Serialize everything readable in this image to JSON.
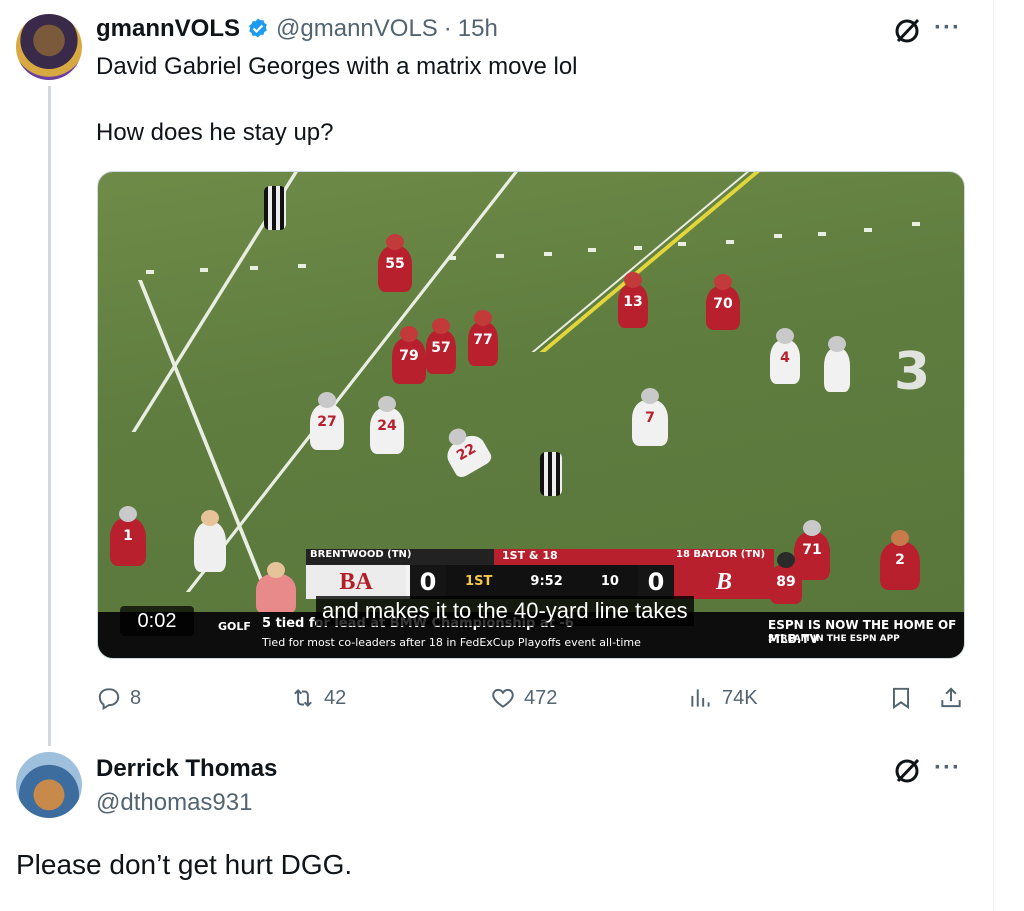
{
  "tweet": {
    "author_name": "gmannVOLS",
    "handle": "@gmannVOLS",
    "separator": "·",
    "time": "15h",
    "text_line1": "David Gabriel Georges with a matrix move lol",
    "text_line2": "How does he stay up?",
    "more": "···",
    "video": {
      "timer": "0:02",
      "caption": "and makes it to the 40-yard line takes",
      "scorebug": {
        "home_team": "BRENTWOOD (TN)",
        "home_logo": "BA",
        "home_score": "0",
        "down": "1ST & 18",
        "quarter": "1ST",
        "clock": "9:52",
        "playclock": "10",
        "away_team": "18 BAYLOR (TN)",
        "away_logo": "B",
        "away_score": "0"
      },
      "ticker": {
        "sport": "GOLF",
        "line1": "5 tied for lead at BMW Championship at -6",
        "line2": "Tied for most co-leaders after 18 in FedExCup Playoffs event all-time",
        "promo1": "ESPN IS NOW THE HOME OF MLB.TV",
        "promo2": "STREAM IN THE ESPN APP"
      },
      "jersey_numbers": [
        "55",
        "79",
        "57",
        "77",
        "13",
        "70",
        "27",
        "24",
        "7",
        "4",
        "1",
        "71",
        "2",
        "22",
        "89"
      ],
      "yard_marker": "3"
    },
    "actions": {
      "replies": "8",
      "reposts": "42",
      "likes": "472",
      "views": "74K"
    }
  },
  "reply": {
    "author_name": "Derrick Thomas",
    "handle": "@dthomas931",
    "more": "···",
    "text": "Please don’t get hurt DGG."
  },
  "colors": {
    "verified": "#1d9bf0",
    "secondary_text": "#536471",
    "field": "#5f7d3f"
  }
}
